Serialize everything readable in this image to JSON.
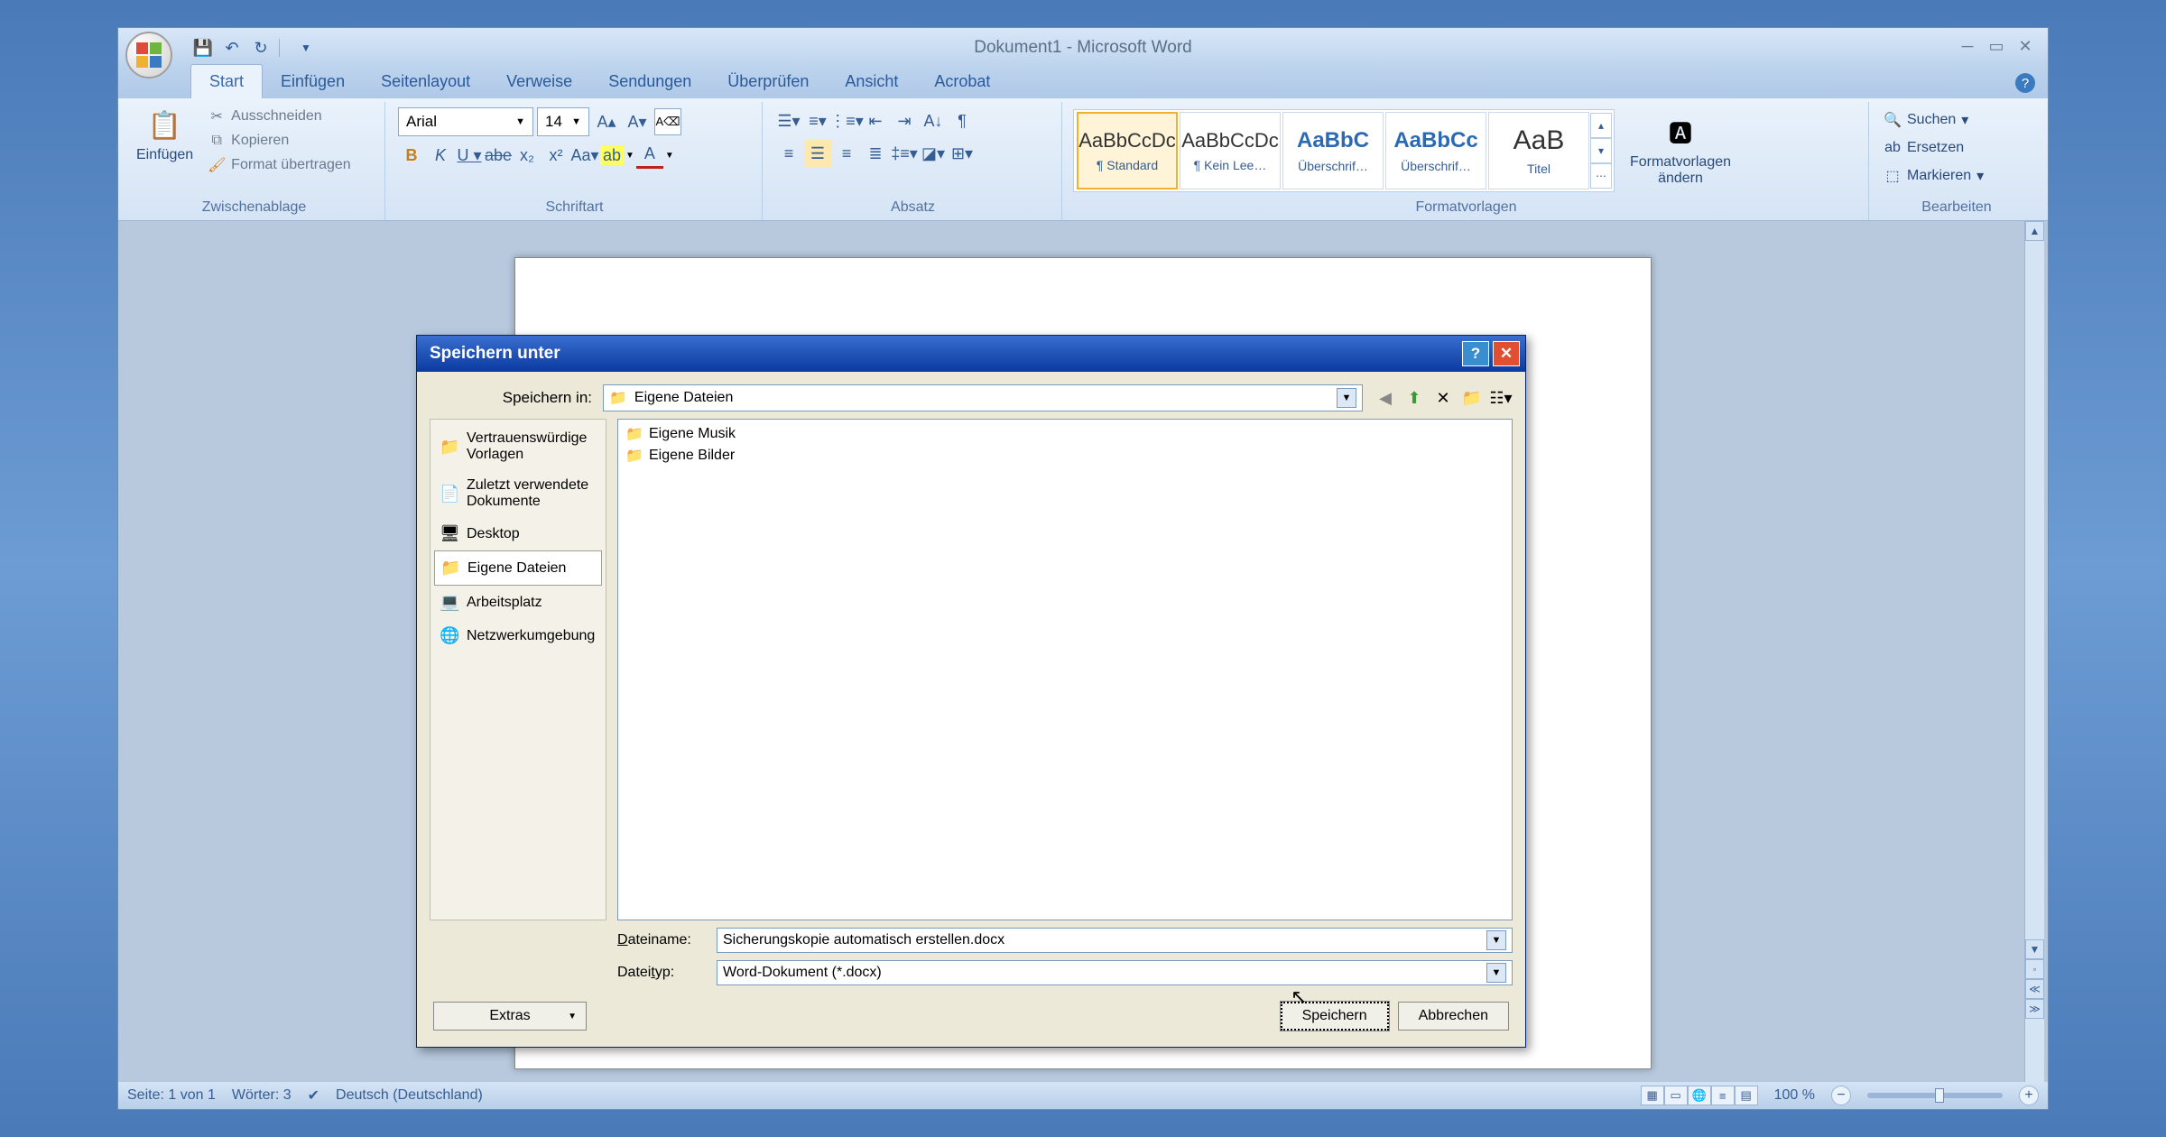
{
  "titlebar": {
    "title": "Dokument1 - Microsoft Word"
  },
  "ribbon_tabs": [
    "Start",
    "Einfügen",
    "Seitenlayout",
    "Verweise",
    "Sendungen",
    "Überprüfen",
    "Ansicht",
    "Acrobat"
  ],
  "clipboard": {
    "paste": "Einfügen",
    "cut": "Ausschneiden",
    "copy": "Kopieren",
    "format_painter": "Format übertragen",
    "group_label": "Zwischenablage"
  },
  "font": {
    "name": "Arial",
    "size": "14",
    "group_label": "Schriftart"
  },
  "paragraph": {
    "group_label": "Absatz"
  },
  "styles": {
    "group_label": "Formatvorlagen",
    "change": "Formatvorlagen ändern",
    "items": [
      {
        "preview": "AaBbCcDc",
        "label": "¶ Standard"
      },
      {
        "preview": "AaBbCcDc",
        "label": "¶ Kein Lee…"
      },
      {
        "preview": "AaBbC",
        "label": "Überschrif…"
      },
      {
        "preview": "AaBbCc",
        "label": "Überschrif…"
      },
      {
        "preview": "AaB",
        "label": "Titel"
      }
    ]
  },
  "editing": {
    "find": "Suchen",
    "replace": "Ersetzen",
    "select": "Markieren",
    "group_label": "Bearbeiten"
  },
  "statusbar": {
    "page": "Seite: 1 von 1",
    "words": "Wörter: 3",
    "lang": "Deutsch (Deutschland)",
    "zoom": "100 %"
  },
  "dialog": {
    "title": "Speichern unter",
    "save_in_label": "Speichern in:",
    "location": "Eigene Dateien",
    "places": [
      {
        "icon": "📁",
        "label": "Vertrauenswürdige Vorlagen"
      },
      {
        "icon": "📄",
        "label": "Zuletzt verwendete Dokumente"
      },
      {
        "icon": "🖥",
        "label": "Desktop"
      },
      {
        "icon": "📁",
        "label": "Eigene Dateien"
      },
      {
        "icon": "💻",
        "label": "Arbeitsplatz"
      },
      {
        "icon": "🌐",
        "label": "Netzwerkumgebung"
      }
    ],
    "files": [
      {
        "label": "Eigene Musik"
      },
      {
        "label": "Eigene Bilder"
      }
    ],
    "filename_label": "Dateiname:",
    "filetype_label": "Dateityp:",
    "filename": "Sicherungskopie automatisch erstellen.docx",
    "filetype": "Word-Dokument (*.docx)",
    "extras": "Extras",
    "save": "Speichern",
    "cancel": "Abbrechen"
  }
}
